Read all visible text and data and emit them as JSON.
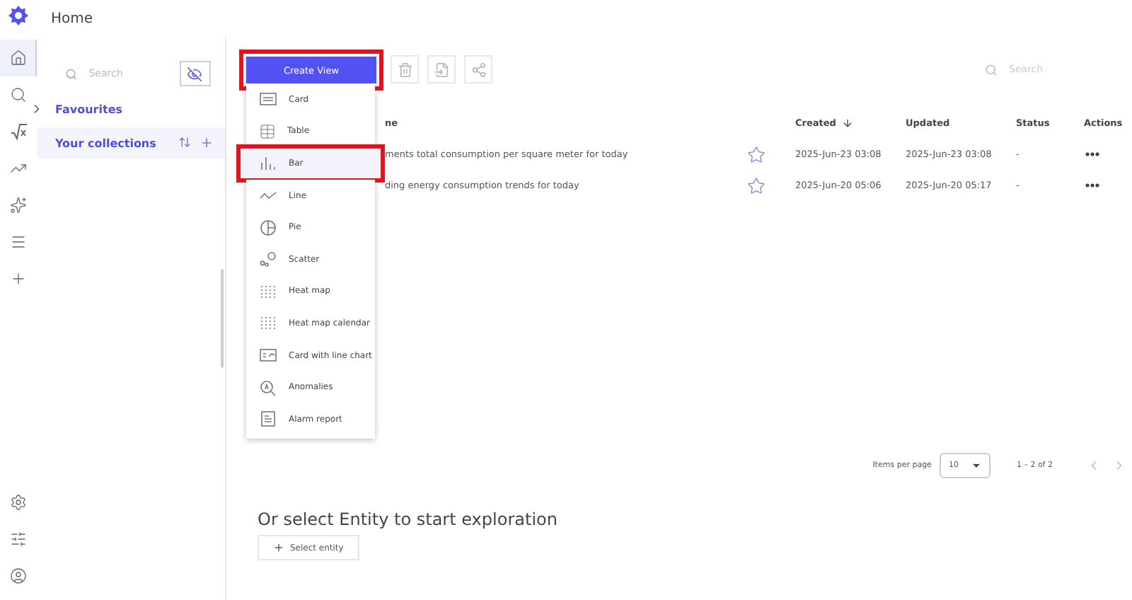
{
  "header": {
    "title": "Home"
  },
  "rail": {
    "items": [
      {
        "kind": "home",
        "selected": true
      },
      {
        "kind": "explore",
        "selected": false
      },
      {
        "kind": "formula",
        "selected": false
      },
      {
        "kind": "trend",
        "selected": false
      },
      {
        "kind": "sparkles",
        "selected": false
      },
      {
        "kind": "list",
        "selected": false
      },
      {
        "kind": "add",
        "selected": false
      }
    ],
    "bottom": [
      {
        "kind": "settings"
      },
      {
        "kind": "sliders"
      },
      {
        "kind": "user"
      }
    ]
  },
  "side_panel": {
    "search": {
      "placeholder": "Search"
    },
    "sections": [
      {
        "label": "Favourites",
        "selected": false
      },
      {
        "label": "Your collections",
        "selected": true
      }
    ]
  },
  "create_menu": {
    "button": {
      "label": "Create View",
      "highlighted": true
    },
    "items": [
      {
        "kind": "card",
        "label": "Card",
        "highlighted": false
      },
      {
        "kind": "table",
        "label": "Table",
        "highlighted": false
      },
      {
        "kind": "bar",
        "label": "Bar",
        "highlighted": true
      },
      {
        "kind": "line",
        "label": "Line",
        "highlighted": false
      },
      {
        "kind": "pie",
        "label": "Pie",
        "highlighted": false
      },
      {
        "kind": "scatter",
        "label": "Scatter",
        "highlighted": false
      },
      {
        "kind": "heatmap",
        "label": "Heat map",
        "highlighted": false
      },
      {
        "kind": "heatmap",
        "label": "Heat map calendar",
        "highlighted": false
      },
      {
        "kind": "cardline",
        "label": "Card with line chart",
        "highlighted": false
      },
      {
        "kind": "anomalies",
        "label": "Anomalies",
        "highlighted": false
      },
      {
        "kind": "report",
        "label": "Alarm report",
        "highlighted": false
      }
    ]
  },
  "search": {
    "placeholder": "Search"
  },
  "table": {
    "columns": [
      "ne",
      "Created",
      "Updated",
      "Status",
      "Actions"
    ],
    "rows": [
      {
        "name": "ments total consumption per square meter for today",
        "favourite": false,
        "created": "2025-Jun-23 03:08",
        "updated": "2025-Jun-23 03:08",
        "status": "-"
      },
      {
        "name": "ding energy consumption trends for today",
        "favourite": false,
        "created": "2025-Jun-20 05:06",
        "updated": "2025-Jun-20 05:17",
        "status": "-"
      }
    ]
  },
  "pagination": {
    "label": "Items per page",
    "page_size": "10",
    "range": "1 – 2 of 2"
  },
  "explore": {
    "heading": "Or select Entity to start exploration",
    "button": "Select entity"
  }
}
